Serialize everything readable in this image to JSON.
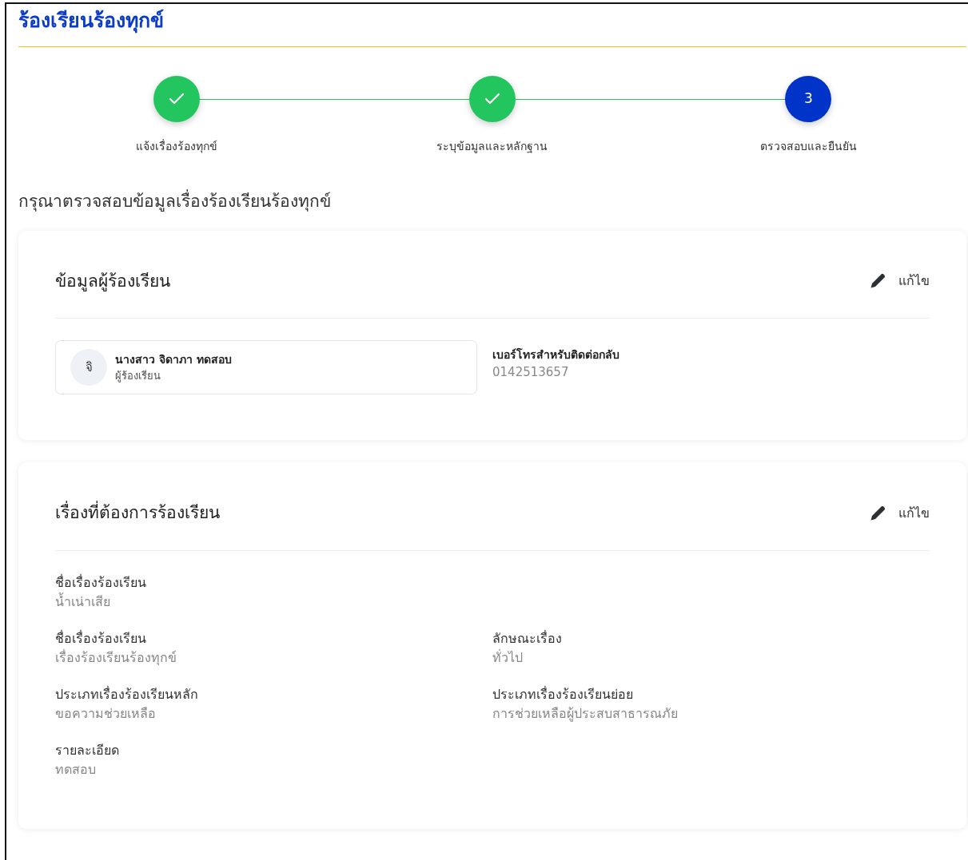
{
  "title": "ร้องเรียนร้องทุกข์",
  "steps": [
    {
      "label": "แจ้งเรื่องร้องทุกข์",
      "completed": true
    },
    {
      "label": "ระบุข้อมูลและหลักฐาน",
      "completed": true
    },
    {
      "label": "ตรวจสอบและยืนยัน",
      "completed": false,
      "number": "3"
    }
  ],
  "instruction": "กรุณาตรวจสอบข้อมูลเรื่องร้องเรียนร้องทุกข์",
  "complainant_card": {
    "title": "ข้อมูลผู้ร้องเรียน",
    "edit_label": "แก้ไข",
    "person": {
      "initial": "จิ",
      "name": "นางสาว จิดาภา ทดสอบ",
      "role": "ผู้ร้องเรียน"
    },
    "phone": {
      "label": "เบอร์โทรสำหรับติดต่อกลับ",
      "value": "0142513657"
    }
  },
  "complaint_card": {
    "title": "เรื่องที่ต้องการร้องเรียน",
    "edit_label": "แก้ไข",
    "rows": [
      [
        {
          "label": "ชื่อเรื่องร้องเรียน",
          "value": "น้ำเน่าเสีย"
        }
      ],
      [
        {
          "label": "ชื่อเรื่องร้องเรียน",
          "value": "เรื่องร้องเรียนร้องทุกข์"
        },
        {
          "label": "ลักษณะเรื่อง",
          "value": "ทั่วไป"
        }
      ],
      [
        {
          "label": "ประเภทเรื่องร้องเรียนหลัก",
          "value": "ขอความช่วยเหลือ"
        },
        {
          "label": "ประเภทเรื่องร้องเรียนย่อย",
          "value": "การช่วยเหลือผู้ประสบสาธารณภัย"
        }
      ],
      [
        {
          "label": "รายละเอียด",
          "value": "ทดสอบ"
        }
      ]
    ]
  }
}
